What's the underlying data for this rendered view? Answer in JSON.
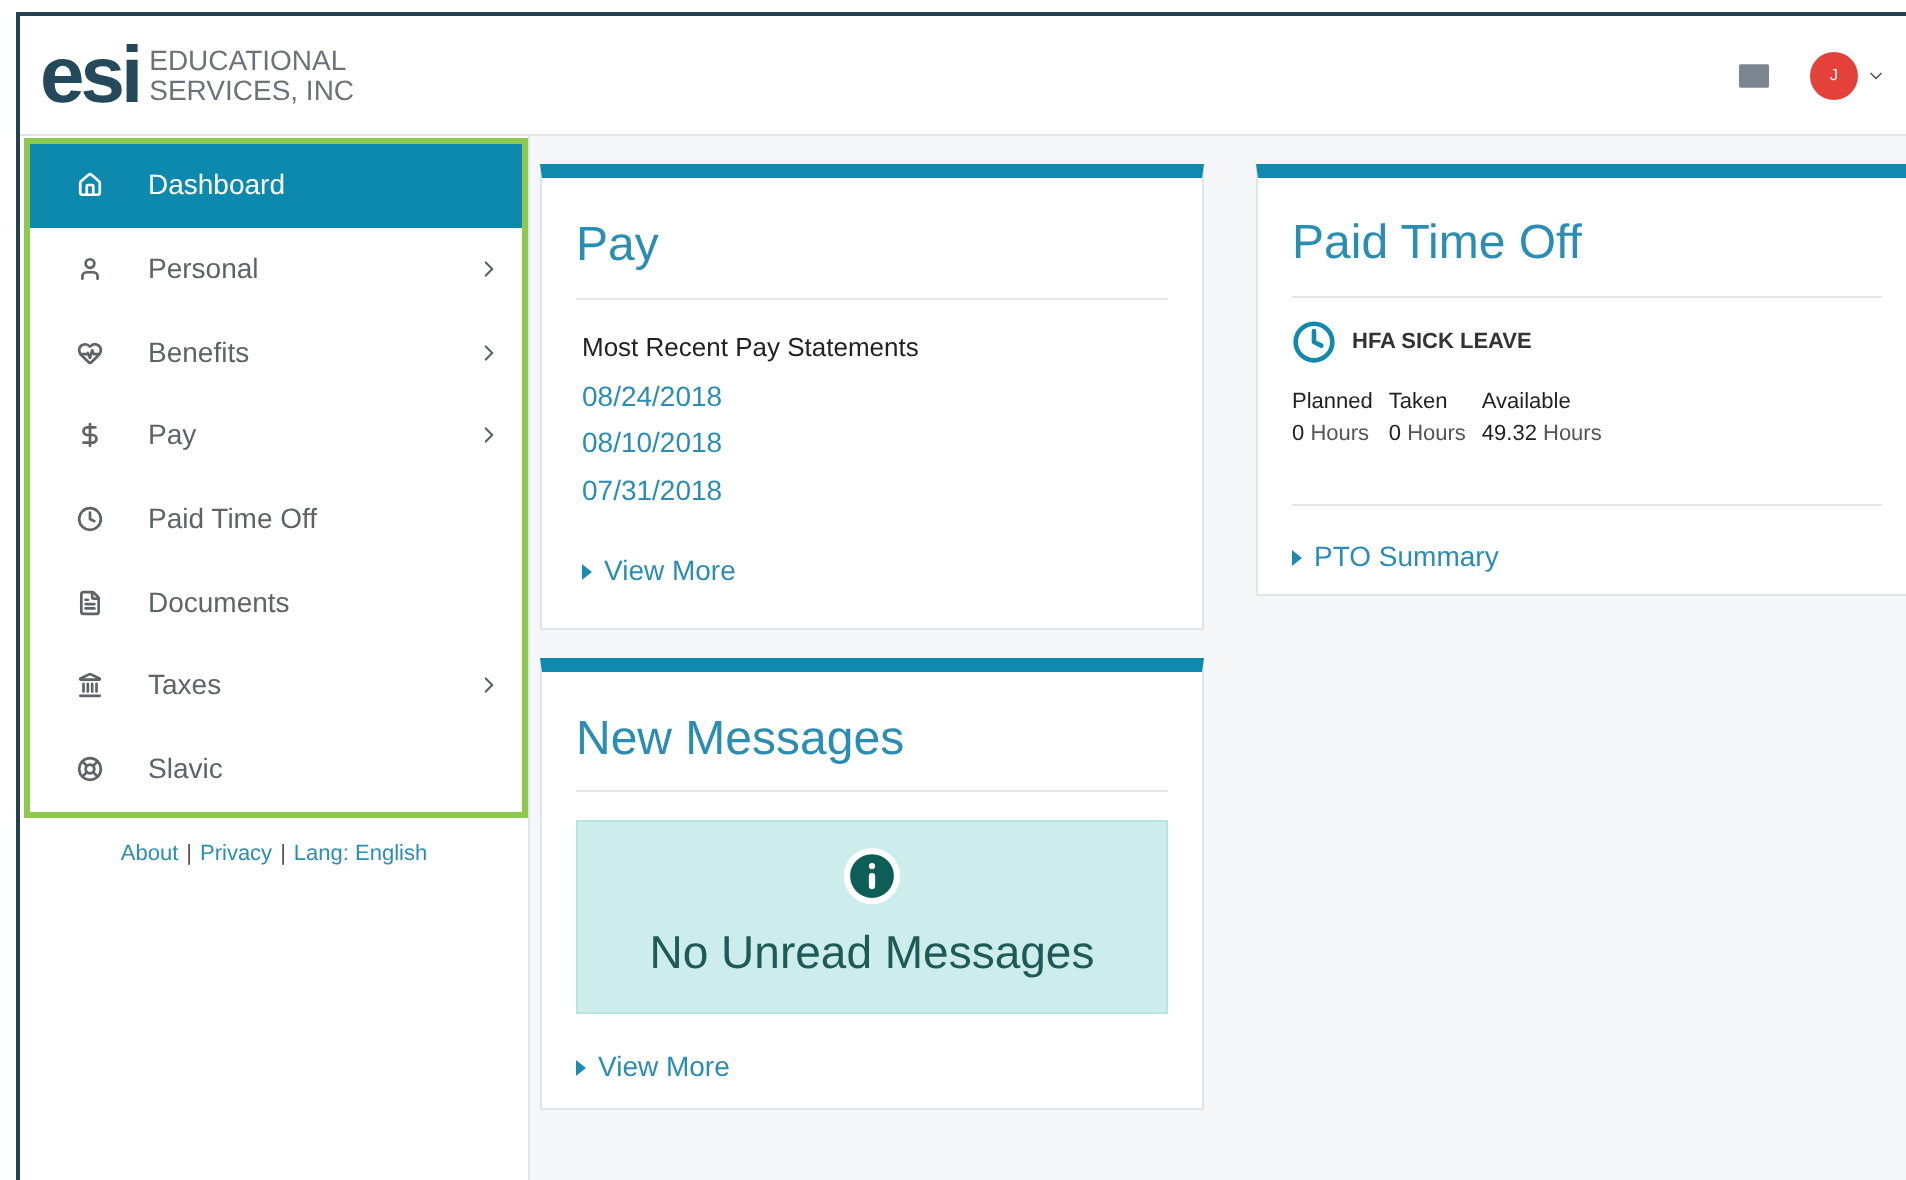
{
  "header": {
    "logo": "esi",
    "company": [
      "EDUCATIONAL",
      "SERVICES, INC"
    ],
    "avatar": "J"
  },
  "sidebar": {
    "items": [
      {
        "label": "Dashboard",
        "selected": true,
        "expandable": false
      },
      {
        "label": "Personal",
        "selected": false,
        "expandable": true
      },
      {
        "label": "Benefits",
        "selected": false,
        "expandable": true
      },
      {
        "label": "Pay",
        "selected": false,
        "expandable": true
      },
      {
        "label": "Paid Time Off",
        "selected": false,
        "expandable": false
      },
      {
        "label": "Documents",
        "selected": false,
        "expandable": false
      },
      {
        "label": "Taxes",
        "selected": false,
        "expandable": true
      },
      {
        "label": "Slavic",
        "selected": false,
        "expandable": false
      }
    ],
    "footer": [
      {
        "kind": "link",
        "text": "About"
      },
      {
        "kind": "separator",
        "text": "|"
      },
      {
        "kind": "link",
        "text": "Privacy"
      },
      {
        "kind": "separator",
        "text": "|"
      },
      {
        "kind": "link",
        "text": "Lang: English"
      }
    ]
  },
  "pay": {
    "title": "Pay",
    "subtitle": "Most Recent Pay Statements",
    "statements": [
      "08/24/2018",
      "08/10/2018",
      "07/31/2018"
    ],
    "more": "View More"
  },
  "messages": {
    "title": "New Messages",
    "notice": "No Unread Messages",
    "more": "View More"
  },
  "pto": {
    "title": "Paid Time Off",
    "plan": "HFA SICK LEAVE",
    "columns": [
      {
        "label": "Planned",
        "value": "0",
        "unit": "Hours"
      },
      {
        "label": "Taken",
        "value": "0",
        "unit": "Hours"
      },
      {
        "label": "Available",
        "value": "49.32",
        "unit": "Hours"
      }
    ],
    "more": "PTO Summary"
  }
}
